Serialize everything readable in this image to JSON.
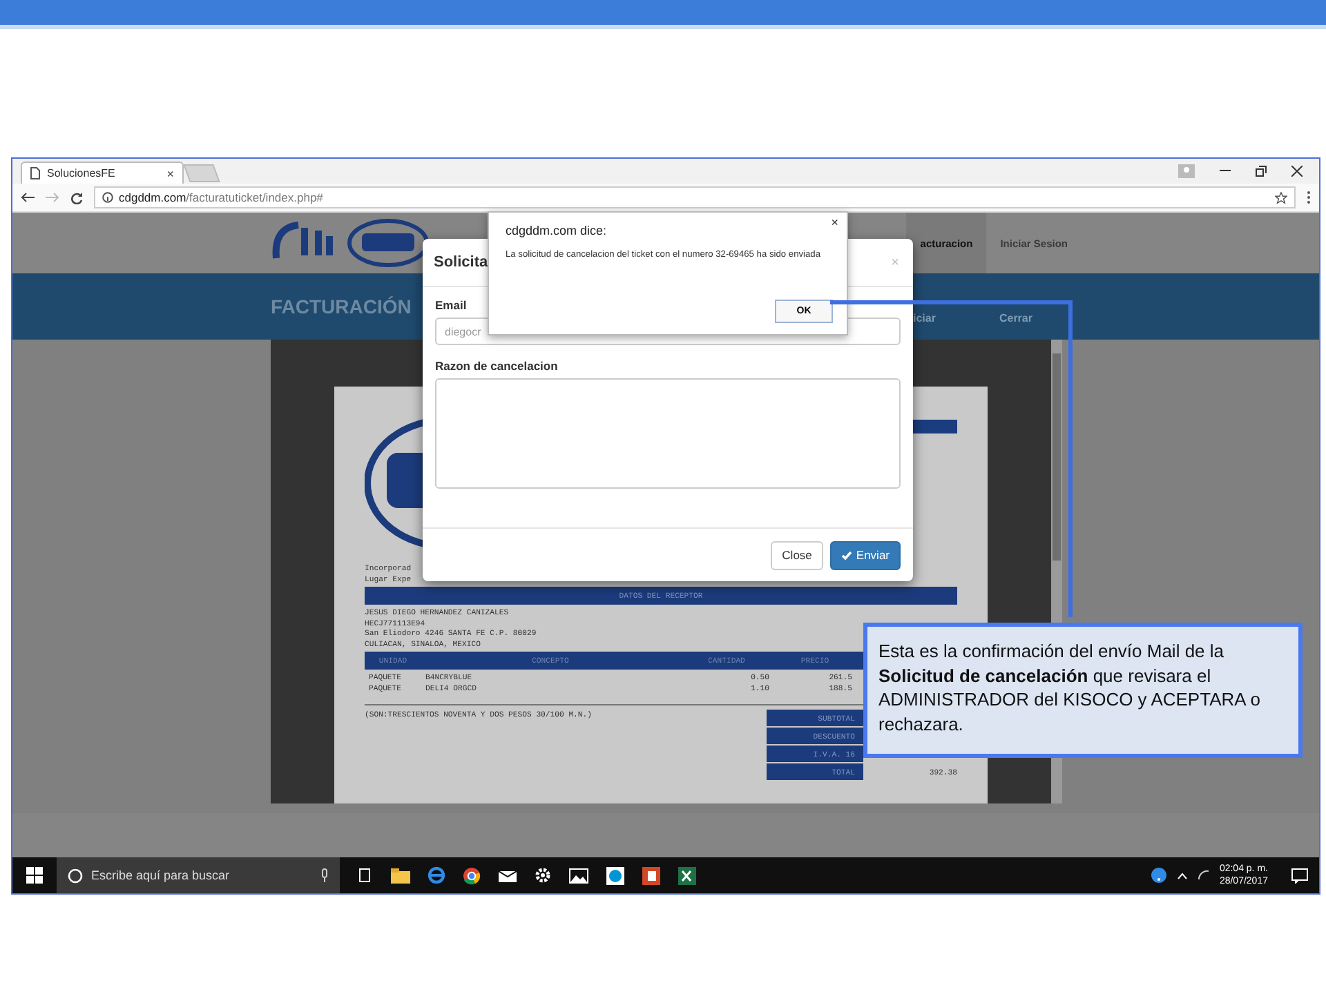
{
  "browser": {
    "tab": {
      "title": "SolucionesFE",
      "close": "×"
    },
    "url": {
      "host": "cdgddm.com",
      "path": "/facturatuticket/index.php#"
    }
  },
  "site": {
    "nav": [
      "acturacion",
      "Iniciar Sesion"
    ],
    "band_title": "FACTURACIÓN",
    "band_nav": [
      "iciar",
      "Cerrar"
    ]
  },
  "invoice": {
    "issuer_lines": [
      "Incorporad",
      "Lugar Expe"
    ],
    "receptor_title": "DATOS DEL RECEPTOR",
    "receptor_lines": [
      "JESUS DIEGO HERNANDEZ CANIZALES",
      "HECJ771113E94",
      "San Eliodoro 4246 SANTA FE C.P. 80029",
      "CULIACAN, SINALOA, MEXICO"
    ],
    "columns": [
      "UNIDAD",
      "CONCEPTO",
      "CANTIDAD",
      "PRECIO"
    ],
    "rows": [
      [
        "PAQUETE",
        "B4NCRYBLUE",
        "0.50",
        "261.5"
      ],
      [
        "PAQUETE",
        "DELI4 ORGCD",
        "1.10",
        "188.5"
      ]
    ],
    "amount_words": "(SON:TRESCIENTOS NOVENTA Y DOS PESOS 30/100 M.N.)",
    "totals": [
      {
        "label": "SUBTOTAL"
      },
      {
        "label": "DESCUENTO"
      },
      {
        "label": "I.V.A. 16"
      },
      {
        "label": "TOTAL",
        "value": "392.38"
      }
    ]
  },
  "modal": {
    "title": "Solicita",
    "close": "×",
    "email_label": "Email",
    "email_value": "diegocr",
    "reason_label": "Razon de cancelacion",
    "buttons": [
      {
        "label": "Close",
        "kind": "default"
      },
      {
        "label": "Enviar",
        "kind": "primary"
      }
    ]
  },
  "alert": {
    "title": "cdgddm.com dice:",
    "message": "La solicitud de cancelacion del ticket con el numero 32-69465 ha sido enviada",
    "ok": "OK",
    "close": "×"
  },
  "callout": "Esta es la confirmación del envío Mail de la **Solicitud de cancelación** que revisara el ADMINISTRADOR del KISOCO y ACEPTARA o rechazara.",
  "taskbar": {
    "search_placeholder": "Escribe aquí para buscar",
    "time": "02:04 p. m.",
    "date": "28/07/2017"
  }
}
